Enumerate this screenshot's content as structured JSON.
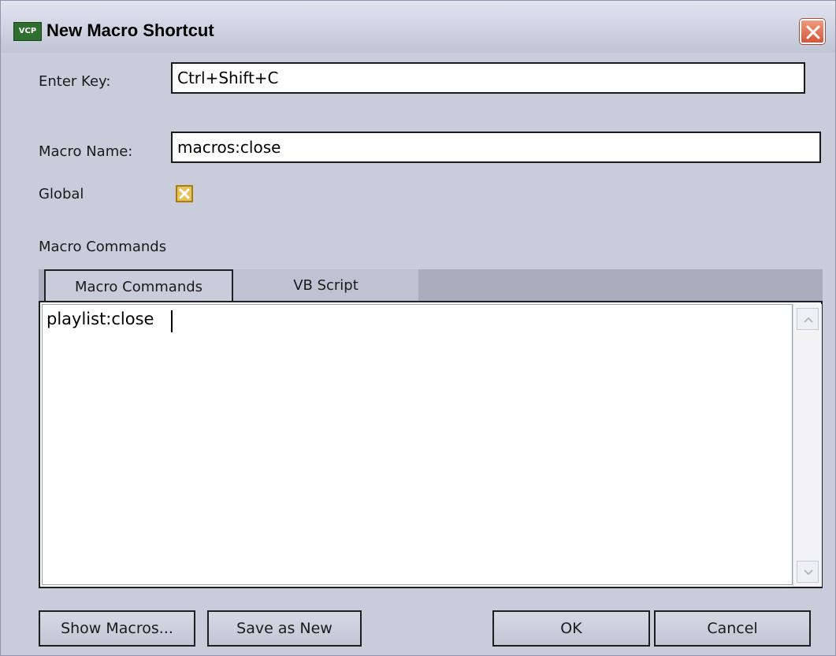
{
  "window": {
    "title": "New Macro Shortcut",
    "app_icon_text": "VCP",
    "close_icon": "close-icon"
  },
  "form": {
    "enter_key_label": "Enter Key:",
    "enter_key_value": "Ctrl+Shift+C",
    "macro_name_label": "Macro Name:",
    "macro_name_value": "macros:close",
    "global_label": "Global",
    "global_checked": true,
    "macro_commands_label": "Macro Commands"
  },
  "tabs": [
    {
      "label": "Macro Commands",
      "active": true
    },
    {
      "label": "VB Script",
      "active": false
    }
  ],
  "editor": {
    "content": "playlist:close"
  },
  "buttons": {
    "show_macros": "Show Macros...",
    "save_as_new": "Save as New",
    "ok": "OK",
    "cancel": "Cancel"
  },
  "colors": {
    "dialog_background": "#c8ccdb",
    "close_button": "#d4563b",
    "checkbox": "#e8c15a"
  }
}
